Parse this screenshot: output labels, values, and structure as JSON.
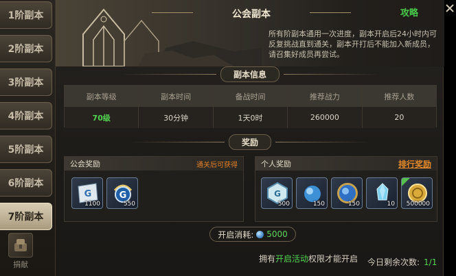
{
  "tabs": [
    {
      "label": "1阶副本"
    },
    {
      "label": "2阶副本"
    },
    {
      "label": "3阶副本"
    },
    {
      "label": "4阶副本"
    },
    {
      "label": "5阶副本"
    },
    {
      "label": "6阶副本"
    },
    {
      "label": "7阶副本"
    }
  ],
  "active_tab": 6,
  "donate": {
    "label": "捐献",
    "icon": "donate-icon"
  },
  "header": {
    "title": "公会副本",
    "strategy_label": "攻略",
    "description": "所有阶副本通用一次进度，副本开启后24小时内可反复挑战直到通关，副本开打后不能加入新成员，请召集好成员再尝试。"
  },
  "info": {
    "section_title": "副本信息",
    "headers": [
      "副本等级",
      "副本时间",
      "备战时间",
      "推荐战力",
      "推荐人数"
    ],
    "values": [
      "70级",
      "30分钟",
      "1天0时",
      "260000",
      "20"
    ]
  },
  "rewards": {
    "section_title": "奖励",
    "guild": {
      "title": "公会奖励",
      "note": "通关后可获得",
      "items": [
        {
          "icon": "guild-card-icon",
          "count": "1100"
        },
        {
          "icon": "guild-badge-icon",
          "count": "550"
        }
      ]
    },
    "personal": {
      "title": "个人奖励",
      "rank_link": "排行奖励",
      "items": [
        {
          "icon": "guild-token-icon",
          "count": "500"
        },
        {
          "icon": "blue-orb-icon",
          "count": "150"
        },
        {
          "icon": "orb-coin-icon",
          "count": "150"
        },
        {
          "icon": "crystal-icon",
          "count": "10"
        },
        {
          "icon": "gold-coin-icon",
          "count": "500000"
        }
      ]
    }
  },
  "cost": {
    "label": "开启消耗:",
    "value": "5000",
    "icon": "gem-icon"
  },
  "permission": {
    "prefix": "拥有",
    "highlight": "开启活动",
    "suffix": "权限才能开启"
  },
  "remaining": {
    "label": "今日剩余次数:",
    "value": "1/1"
  },
  "colors": {
    "accent_green": "#52d34f",
    "accent_orange": "#e68a2a",
    "panel_bg": "#1d1b18"
  }
}
